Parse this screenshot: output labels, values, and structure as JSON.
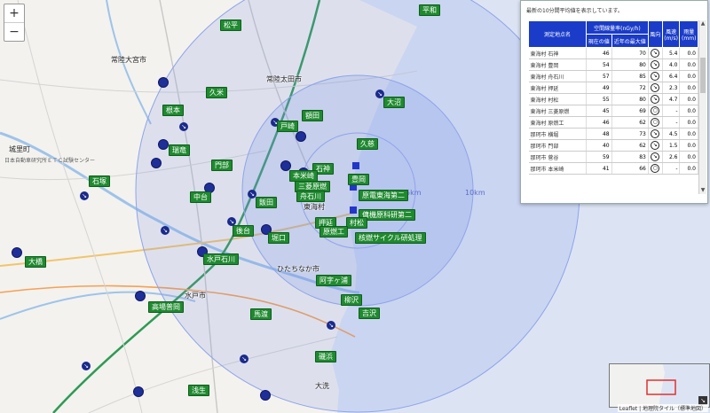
{
  "map": {
    "places": [
      {
        "name": "常陸大宮市",
        "cls": ""
      },
      {
        "name": "常陸太田市",
        "cls": ""
      },
      {
        "name": "城里町",
        "cls": ""
      },
      {
        "name": "日本自動車研究所ＥＴＣ試験センター",
        "cls": "small"
      },
      {
        "name": "東海村",
        "cls": ""
      },
      {
        "name": "ひたちなか市",
        "cls": ""
      },
      {
        "name": "水戸市",
        "cls": ""
      },
      {
        "name": "大洗",
        "cls": ""
      }
    ],
    "ring_labels": [
      "5km",
      "10km"
    ],
    "stations": [
      {
        "name": "松平"
      },
      {
        "name": "平和"
      },
      {
        "name": "久米"
      },
      {
        "name": "根本"
      },
      {
        "name": "大沼"
      },
      {
        "name": "瑞竜"
      },
      {
        "name": "戸崎"
      },
      {
        "name": "門部"
      },
      {
        "name": "額田"
      },
      {
        "name": "石神"
      },
      {
        "name": "久慈"
      },
      {
        "name": "豊岡"
      },
      {
        "name": "本米崎"
      },
      {
        "name": "三菱原燃"
      },
      {
        "name": "舟石川"
      },
      {
        "name": "原電東海第二"
      },
      {
        "name": "押延"
      },
      {
        "name": "傭機原科研第二"
      },
      {
        "name": "村松"
      },
      {
        "name": "原燃工"
      },
      {
        "name": "核燃サイクル研処理"
      },
      {
        "name": "石塚"
      },
      {
        "name": "中台"
      },
      {
        "name": "飯田"
      },
      {
        "name": "後台"
      },
      {
        "name": "堀口"
      },
      {
        "name": "大橋"
      },
      {
        "name": "水戸石川"
      },
      {
        "name": "馬渡"
      },
      {
        "name": "高場普岡"
      },
      {
        "name": "阿字ヶ浦"
      },
      {
        "name": "柳沢"
      },
      {
        "name": "吉沢"
      },
      {
        "name": "磯浜"
      },
      {
        "name": "浅生"
      }
    ]
  },
  "panel": {
    "note": "最新の10分間平均値を表示しています。",
    "headers": {
      "location": "測定地点名",
      "dose_group": "空間線量率(nGy/h)",
      "current": "現在の値",
      "recent_max": "近年の最大値",
      "direction": "風向",
      "speed": "風速",
      "speed_unit": "(m/s)",
      "rain": "雨量",
      "rain_unit": "(mm)"
    },
    "rows": [
      {
        "name": "東海村 石神",
        "current": "46",
        "max": "70",
        "dir": "↘",
        "speed": "5.4",
        "rain": "0.0"
      },
      {
        "name": "東海村 豊岡",
        "current": "54",
        "max": "80",
        "dir": "↘",
        "speed": "4.0",
        "rain": "0.0"
      },
      {
        "name": "東海村 舟石川",
        "current": "57",
        "max": "85",
        "dir": "↘",
        "speed": "6.4",
        "rain": "0.0"
      },
      {
        "name": "東海村 押延",
        "current": "49",
        "max": "72",
        "dir": "↘",
        "speed": "2.3",
        "rain": "0.0"
      },
      {
        "name": "東海村 村松",
        "current": "55",
        "max": "80",
        "dir": "↘",
        "speed": "4.7",
        "rain": "0.0"
      },
      {
        "name": "東海村 三菱原燃",
        "current": "45",
        "max": "69",
        "dir": "○",
        "speed": "-",
        "rain": "0.0"
      },
      {
        "name": "東海村 原燃工",
        "current": "46",
        "max": "62",
        "dir": "○",
        "speed": "-",
        "rain": "0.0"
      },
      {
        "name": "那珂市 横堀",
        "current": "48",
        "max": "73",
        "dir": "↘",
        "speed": "4.5",
        "rain": "0.0"
      },
      {
        "name": "那珂市 門部",
        "current": "40",
        "max": "62",
        "dir": "↘",
        "speed": "1.5",
        "rain": "0.0"
      },
      {
        "name": "那珂市 菅谷",
        "current": "59",
        "max": "83",
        "dir": "↘",
        "speed": "2.6",
        "rain": "0.0"
      },
      {
        "name": "那珂市 本米崎",
        "current": "41",
        "max": "66",
        "dir": "○",
        "speed": "-",
        "rain": "0.0"
      }
    ]
  },
  "zoom": {
    "in": "+",
    "out": "−"
  },
  "attribution": "Leaflet | 地理院タイル（標準地図）",
  "minimap_toggle": "↘",
  "colors": {
    "station": "#1f8a2f",
    "dot": "#1f2f9a",
    "ring": "#8fa3ea",
    "header": "#1a3cc8"
  }
}
